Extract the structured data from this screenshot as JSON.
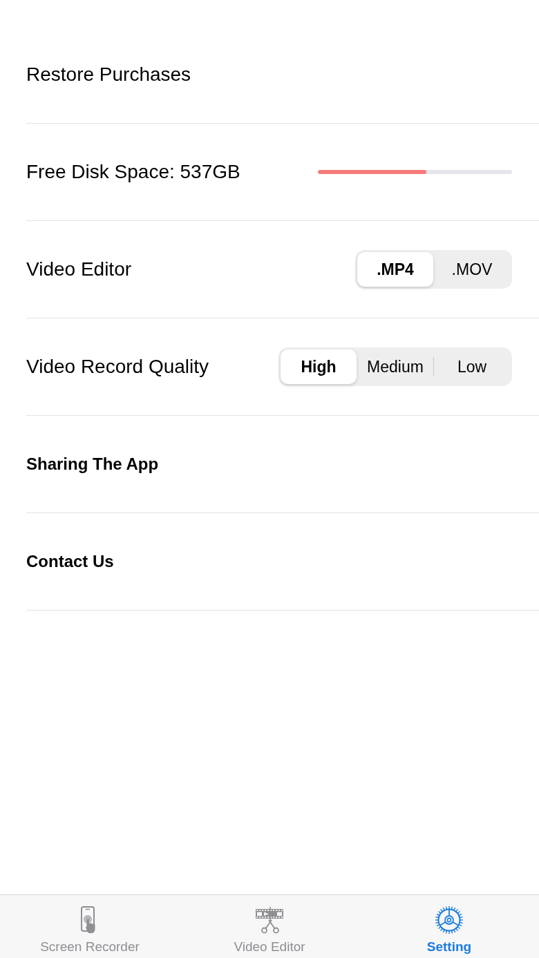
{
  "rows": [
    {
      "kind": "plain",
      "label": "Restore Purchases"
    },
    {
      "kind": "meter",
      "label": "Free Disk Space: 537GB",
      "level": 0.56
    },
    {
      "kind": "segmented",
      "label": "Video Editor",
      "options": [
        {
          "label": ".MP4",
          "selected": true
        },
        {
          "label": ".MOV",
          "selected": false
        }
      ]
    },
    {
      "kind": "segmented",
      "label": "Video Record Quality",
      "options": [
        {
          "label": "High",
          "selected": true
        },
        {
          "label": "Medium",
          "selected": false
        },
        {
          "label": "Low",
          "selected": false
        }
      ]
    },
    {
      "kind": "bold",
      "label": "Sharing The App"
    },
    {
      "kind": "bold",
      "label": "Contact Us"
    }
  ],
  "tab_bar": {
    "tabs": [
      {
        "label": "Screen Recorder",
        "selected": false
      },
      {
        "label": "Video Editor",
        "selected": false
      },
      {
        "label": "Setting",
        "selected": true
      }
    ]
  }
}
